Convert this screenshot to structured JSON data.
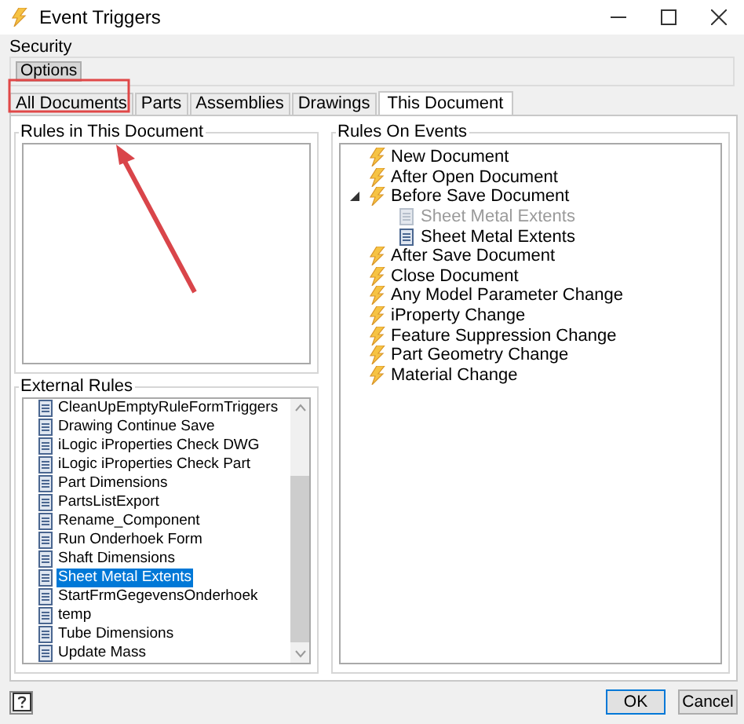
{
  "window": {
    "title": "Event Triggers"
  },
  "security": {
    "label": "Security",
    "button": "Options"
  },
  "tabs": [
    {
      "label": "All Documents",
      "selected": false
    },
    {
      "label": "Parts",
      "selected": false
    },
    {
      "label": "Assemblies",
      "selected": false
    },
    {
      "label": "Drawings",
      "selected": false
    },
    {
      "label": "This Document",
      "selected": true
    }
  ],
  "rules_in_document": {
    "label": "Rules in This Document"
  },
  "external_rules": {
    "label": "External Rules",
    "items": [
      {
        "label": "CleanUpEmptyRuleFormTriggers",
        "selected": false
      },
      {
        "label": "Drawing Continue Save",
        "selected": false
      },
      {
        "label": "iLogic iProperties Check DWG",
        "selected": false
      },
      {
        "label": "iLogic iProperties Check Part",
        "selected": false
      },
      {
        "label": "Part Dimensions",
        "selected": false
      },
      {
        "label": "PartsListExport",
        "selected": false
      },
      {
        "label": "Rename_Component",
        "selected": false
      },
      {
        "label": "Run Onderhoek Form",
        "selected": false
      },
      {
        "label": "Shaft Dimensions",
        "selected": false
      },
      {
        "label": "Sheet Metal Extents",
        "selected": true
      },
      {
        "label": "StartFrmGegevensOnderhoek",
        "selected": false
      },
      {
        "label": "temp",
        "selected": false
      },
      {
        "label": "Tube Dimensions",
        "selected": false
      },
      {
        "label": "Update Mass",
        "selected": false
      }
    ]
  },
  "rules_on_events": {
    "label": "Rules On Events",
    "items": [
      {
        "label": "New Document",
        "kind": "event"
      },
      {
        "label": "After Open Document",
        "kind": "event"
      },
      {
        "label": "Before Save Document",
        "kind": "event",
        "expanded": true,
        "children": [
          {
            "label": "Sheet Metal Extents",
            "kind": "rule",
            "disabled": true
          },
          {
            "label": "Sheet Metal Extents",
            "kind": "rule",
            "disabled": false
          }
        ]
      },
      {
        "label": "After Save Document",
        "kind": "event"
      },
      {
        "label": "Close Document",
        "kind": "event"
      },
      {
        "label": "Any Model Parameter Change",
        "kind": "event"
      },
      {
        "label": "iProperty Change",
        "kind": "event"
      },
      {
        "label": "Feature Suppression Change",
        "kind": "event"
      },
      {
        "label": "Part Geometry Change",
        "kind": "event"
      },
      {
        "label": "Material Change",
        "kind": "event"
      }
    ]
  },
  "buttons": [
    {
      "label": "OK",
      "kind": "default"
    },
    {
      "label": "Cancel",
      "kind": "normal"
    }
  ],
  "annotation": {
    "highlight_box": true,
    "arrow": true
  }
}
